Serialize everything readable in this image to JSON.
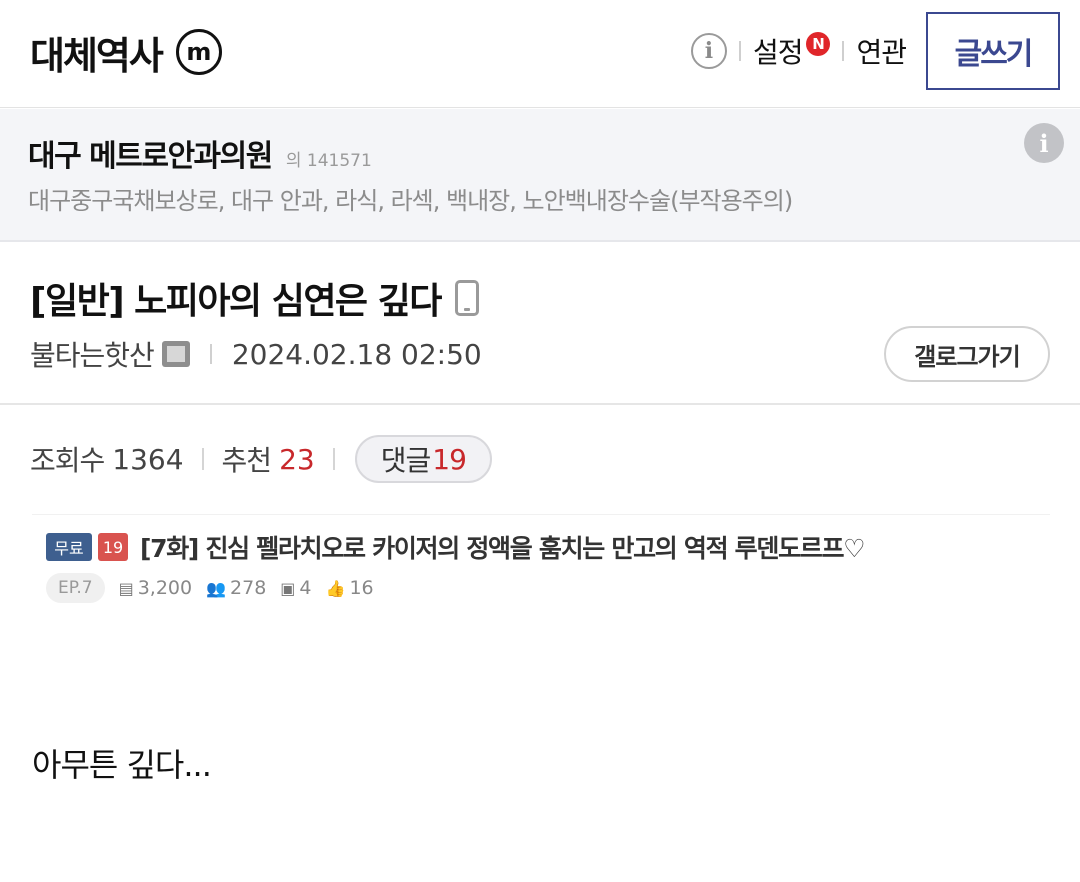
{
  "header": {
    "site_title": "대체역사",
    "site_badge": "m",
    "settings_label": "설정",
    "settings_badge": "N",
    "related_label": "연관",
    "write_label": "글쓰기",
    "info_glyph": "i"
  },
  "ad": {
    "title": "대구 메트로안과의원",
    "tag": "의 141571",
    "description": "대구중구국채보상로, 대구 안과, 라식, 라섹, 백내장, 노안백내장수술(부작용주의)",
    "info_glyph": "i"
  },
  "post": {
    "title": "[일반] 노피아의 심연은 깊다",
    "author": "불타는핫산",
    "date": "2024.02.18 02:50",
    "gallery_button": "갤로그가기"
  },
  "stats": {
    "views_label": "조회수",
    "views_value": "1364",
    "recommend_label": "추천",
    "recommend_value": "23",
    "comments_label": "댓글",
    "comments_value": "19"
  },
  "card": {
    "free_tag": "무료",
    "age_tag": "19",
    "title": "[7화] 진심 펠라치오로 카이저의 정액을 훔치는 만고의 역적 루덴도르프♡",
    "episode": "EP.7",
    "views": "3,200",
    "readers": "278",
    "comments": "4",
    "likes": "16"
  },
  "body": {
    "text": "아무튼 깊다..."
  },
  "colors": {
    "accent_navy": "#3b4890",
    "red": "#c8282b",
    "n_badge": "#e0262a",
    "free_tag": "#3e5f8f",
    "age_tag": "#d9534f"
  }
}
